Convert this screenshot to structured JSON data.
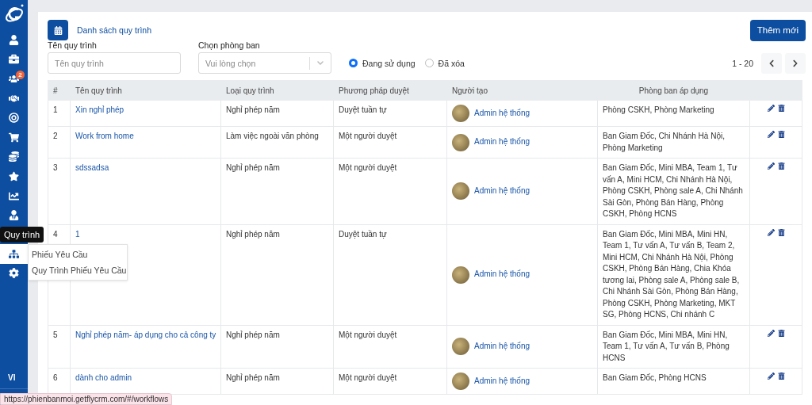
{
  "sidebar": {
    "items": [
      {
        "kind": "user",
        "selected": false
      },
      {
        "kind": "briefcase",
        "selected": false
      },
      {
        "kind": "users",
        "selected": false,
        "badge": "2"
      },
      {
        "kind": "handshake",
        "selected": false
      },
      {
        "kind": "target",
        "selected": false
      },
      {
        "kind": "cart",
        "selected": false
      },
      {
        "kind": "coins",
        "selected": false
      },
      {
        "kind": "star",
        "selected": false
      },
      {
        "kind": "chart",
        "selected": false
      },
      {
        "kind": "user-tie",
        "selected": false
      },
      {
        "kind": "sitemap",
        "selected": true,
        "tooltip": "Quy trình",
        "submenu": [
          "Phiếu Yêu Cầu",
          "Quy Trình Phiếu Yêu Cầu"
        ]
      },
      {
        "kind": "gear",
        "selected": false
      }
    ],
    "language": "VI"
  },
  "header": {
    "title": "Danh sách quy trình",
    "add_button": "Thêm mới"
  },
  "filters": {
    "name_label": "Tên quy trình",
    "name_placeholder": "Tên quy trình",
    "dept_label": "Chọn phòng ban",
    "dept_placeholder": "Vui lòng chọn",
    "status": [
      {
        "label": "Đang sử dụng",
        "selected": true
      },
      {
        "label": "Đã xóa",
        "selected": false
      }
    ]
  },
  "pagination": {
    "range": "1 - 20"
  },
  "table": {
    "columns": [
      "#",
      "Tên quy trình",
      "Loại quy trình",
      "Phương pháp duyệt",
      "Người tạo",
      "Phòng ban áp dụng"
    ],
    "rows": [
      {
        "index": "1",
        "name": "Xin nghỉ phép",
        "type": "Nghỉ phép năm",
        "method": "Duyệt tuần tự",
        "creator": "Admin hệ thống",
        "departments": "Phòng CSKH, Phòng Marketing"
      },
      {
        "index": "2",
        "name": "Work from home",
        "type": "Làm việc ngoài văn phòng",
        "method": "Một người duyệt",
        "creator": "Admin hệ thống",
        "departments": "Ban Giam Đốc, Chi Nhánh Hà Nội, Phòng Marketing"
      },
      {
        "index": "3",
        "name": "sdssadsa",
        "type": "Nghỉ phép năm",
        "method": "Một người duyệt",
        "creator": "Admin hệ thống",
        "departments": "Ban Giam Đốc, Mini MBA, Team 1, Tư vấn A, Mini HCM, Chi Nhánh Hà Nội, Phòng CSKH, Phòng sale A, Chi Nhánh Sài Gòn, Phòng Bán Hàng, Phòng CSKH, Phòng HCNS"
      },
      {
        "index": "4",
        "name": "1",
        "type": "Nghỉ phép năm",
        "method": "Duyệt tuần tự",
        "creator": "Admin hệ thống",
        "departments": "Ban Giam Đốc, Mini MBA, Mini HN, Team 1, Tư vấn A, Tư vấn B, Team 2, Mini HCM, Chi Nhánh Hà Nội, Phòng CSKH, Phòng Bán Hàng, Chia Khóa tương lai, Phòng sale A, Phòng sale B, Chi Nhánh Sài Gòn, Phòng Bán Hàng, Phòng CSKH, Phòng Marketing, MKT SG, Phòng HCNS, Chi nhánh C"
      },
      {
        "index": "5",
        "name": "Nghỉ phép năm- áp dụng cho cả công ty",
        "type": "Nghỉ phép năm",
        "method": "Một người duyệt",
        "creator": "Admin hệ thống",
        "departments": "Ban Giam Đốc, Mini MBA, Mini HN, Team 1, Tư vấn A, Tư vấn B, Phòng HCNS"
      },
      {
        "index": "6",
        "name": "dành cho admin",
        "type": "Nghỉ phép năm",
        "method": "Một người duyệt",
        "creator": "Admin hệ thống",
        "departments": "Ban Giam Đốc, Phòng HCNS"
      }
    ]
  },
  "status_url": "https://phienbanmoi.getflycrm.com/#/workflows"
}
